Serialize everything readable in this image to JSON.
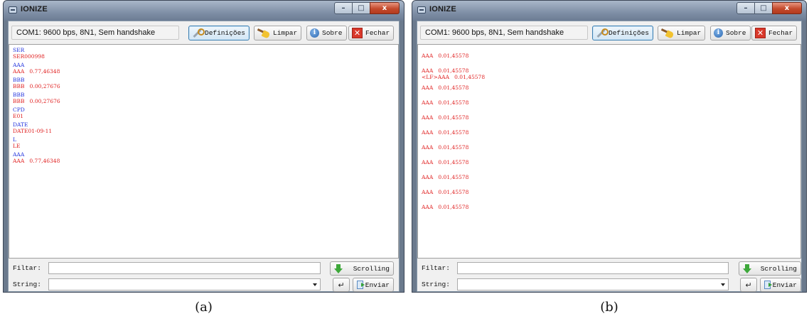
{
  "panels": [
    {
      "caption": "(a)",
      "window": {
        "title": "IONIZE",
        "controls": {
          "minimize": "–",
          "maximize": "□",
          "close": "x"
        }
      },
      "toolbar": {
        "port_status": "COM1: 9600 bps, 8N1, Sem handshake",
        "settings_label": "Definições",
        "clear_label": "Limpar",
        "about_label": "Sobre",
        "close_label": "Fechar"
      },
      "log": [
        {
          "cmd": "SER",
          "resp": "SER000998"
        },
        {
          "cmd": "AAA",
          "resp": "AAA   0.77,46348"
        },
        {
          "cmd": "BBB",
          "resp": "BBB   0.00,27676"
        },
        {
          "cmd": "BBB",
          "resp": "BBB   0.00,27676"
        },
        {
          "cmd": "CPD",
          "resp": "E01"
        },
        {
          "cmd": "DATE",
          "resp": "DATE01-09-11"
        },
        {
          "cmd": "L",
          "resp": "LE"
        },
        {
          "cmd": "AAA",
          "resp": "AAA   0.77,46348"
        }
      ],
      "bottom": {
        "filter_label": "Filtar:",
        "filter_value": "",
        "string_label": "String:",
        "string_value": "",
        "scrolling_label": "Scrolling",
        "enter_symbol": "↵",
        "send_label": "Enviar"
      }
    },
    {
      "caption": "(b)",
      "window": {
        "title": "IONIZE",
        "controls": {
          "minimize": "–",
          "maximize": "□",
          "close": "x"
        }
      },
      "toolbar": {
        "port_status": "COM1: 9600 bps, 8N1, Sem handshake",
        "settings_label": "Definições",
        "clear_label": "Limpar",
        "about_label": "Sobre",
        "close_label": "Fechar"
      },
      "log": [
        {
          "lines": [
            "AAA   0.01,45578"
          ]
        },
        {
          "lines": [
            "AAA   0.01,45578",
            "<LF>AAA   0.01,45578"
          ]
        },
        {
          "lines": [
            "AAA   0.01,45578"
          ]
        },
        {
          "lines": [
            "AAA   0.01,45578"
          ]
        },
        {
          "lines": [
            "AAA   0.01,45578"
          ]
        },
        {
          "lines": [
            "AAA   0.01,45578"
          ]
        },
        {
          "lines": [
            "AAA   0.01,45578"
          ]
        },
        {
          "lines": [
            "AAA   0.01,45578"
          ]
        },
        {
          "lines": [
            "AAA   0.01,45578"
          ]
        },
        {
          "lines": [
            "AAA   0.01,45578"
          ]
        },
        {
          "lines": [
            "AAA   0.01,45578"
          ]
        }
      ],
      "bottom": {
        "filter_label": "Filtar:",
        "filter_value": "",
        "string_label": "String:",
        "string_value": "",
        "scrolling_label": "Scrolling",
        "enter_symbol": "↵",
        "send_label": "Enviar"
      }
    }
  ],
  "colors": {
    "command_text": "#2233dd",
    "response_text": "#e02020",
    "close_button": "#d9382a"
  },
  "icons": {
    "settings": "wrench-icon",
    "clear": "broom-icon",
    "about": "info-icon",
    "close": "close-icon",
    "scrolling": "down-arrow-icon",
    "enter": "enter-icon",
    "send": "send-icon"
  }
}
